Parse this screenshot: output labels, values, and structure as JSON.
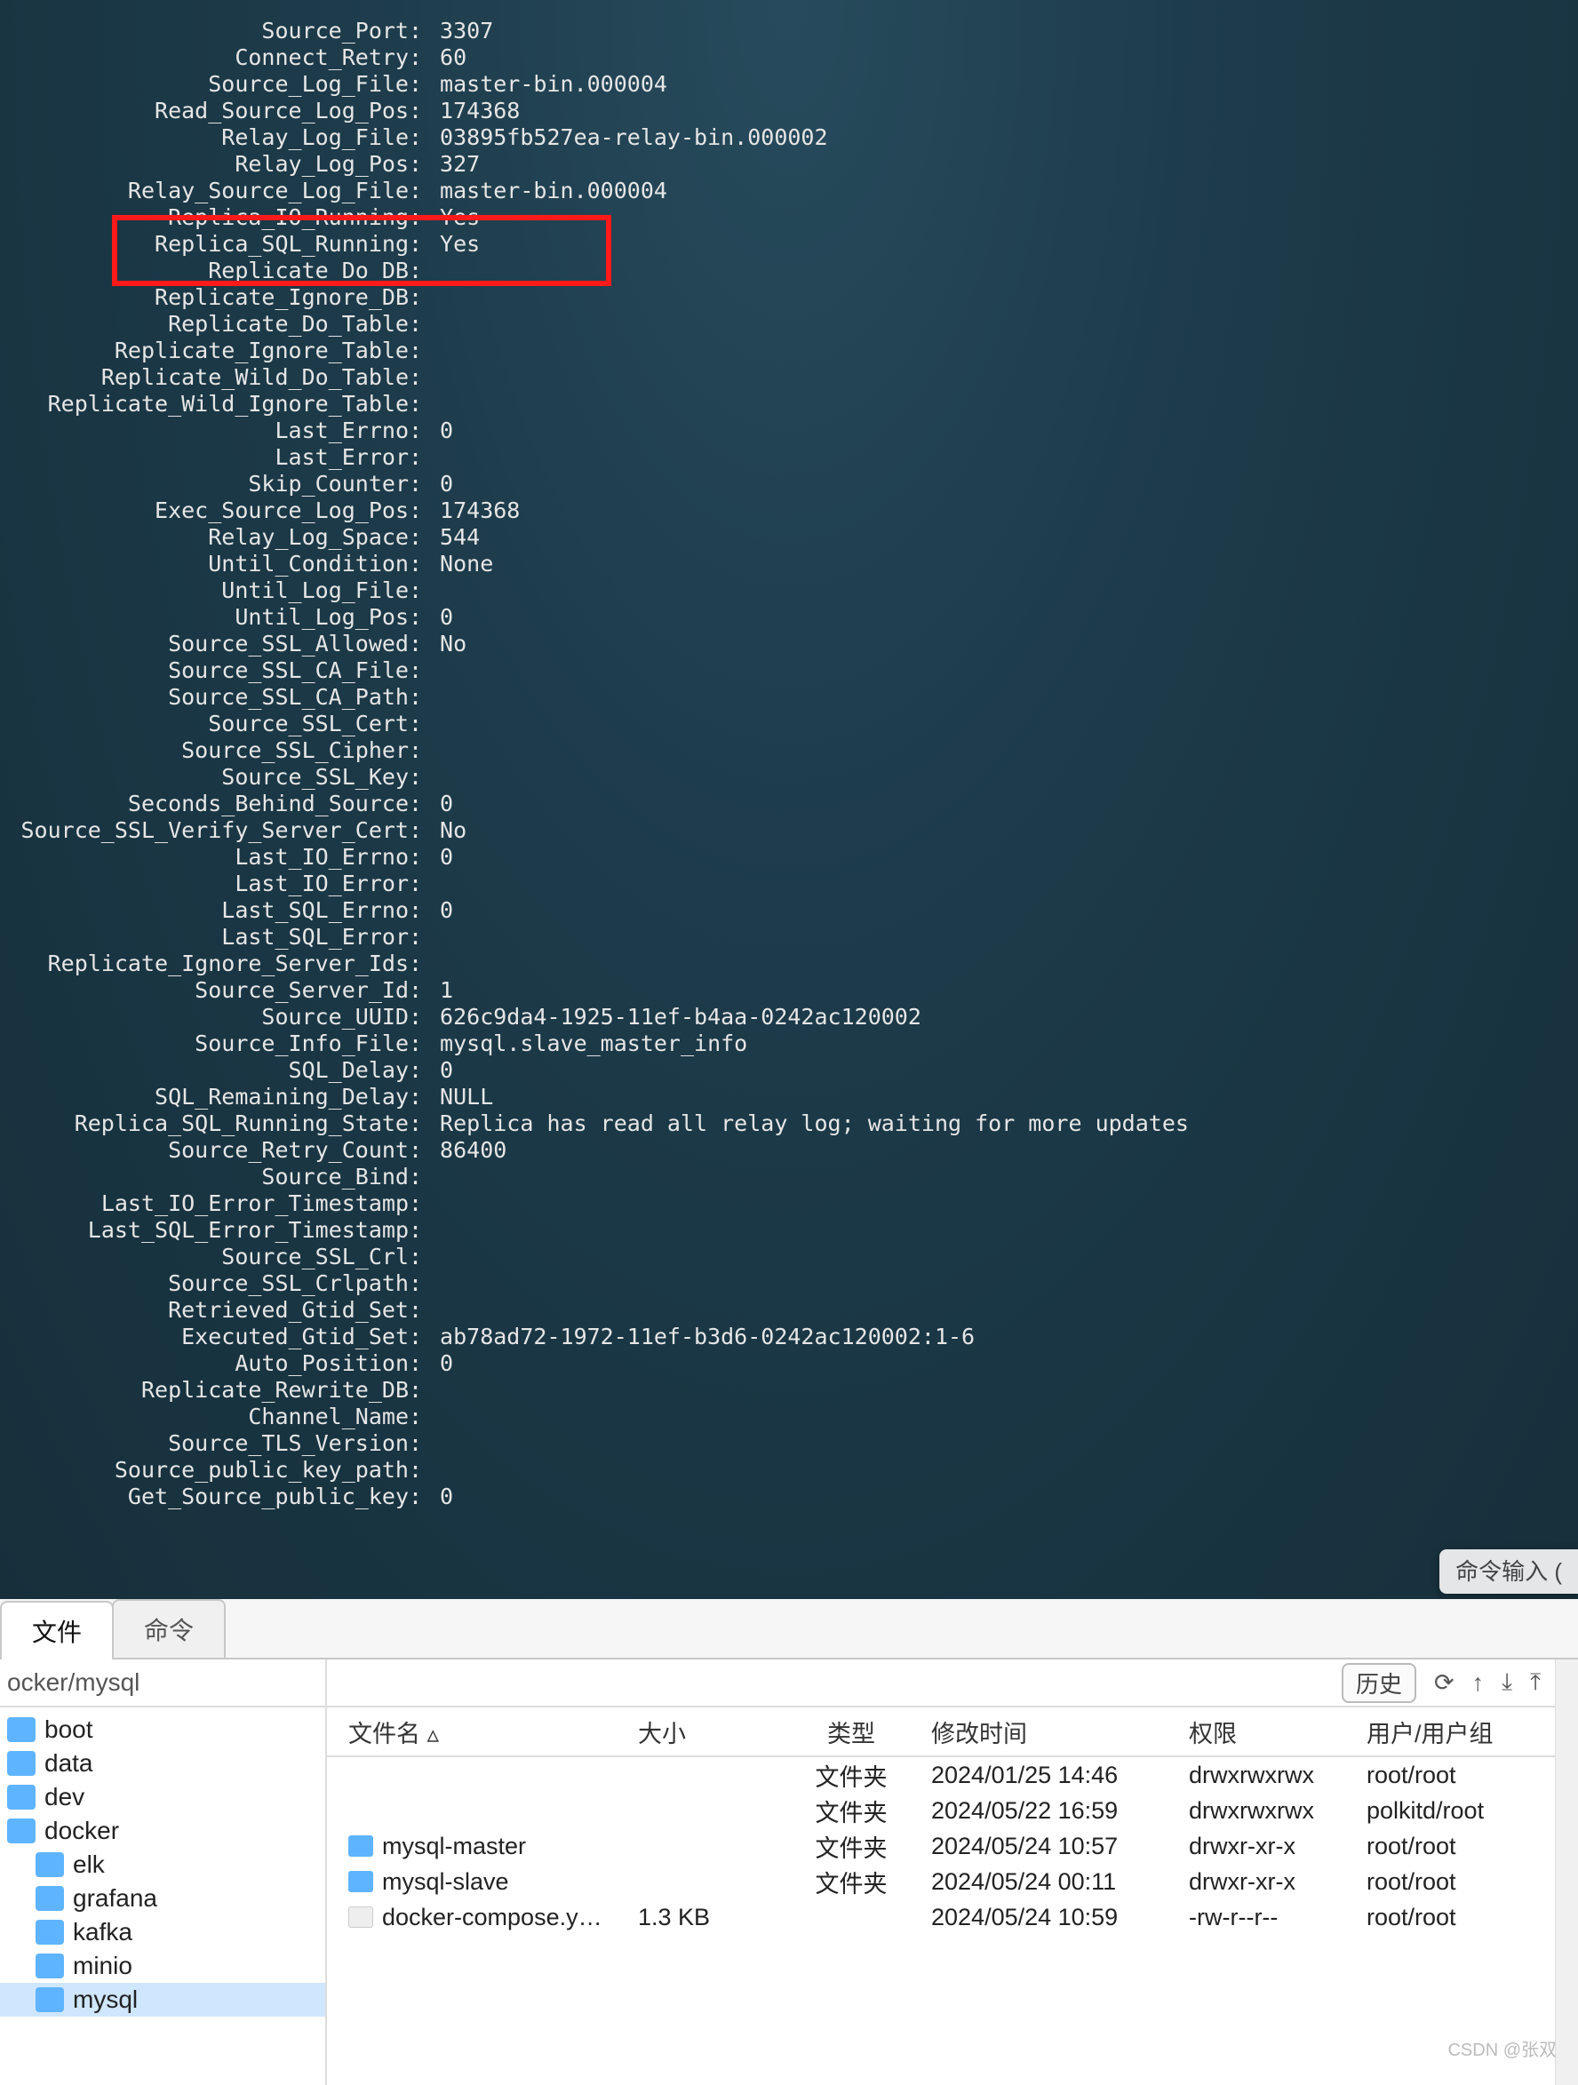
{
  "status": [
    {
      "label": "Source_Port",
      "value": "3307"
    },
    {
      "label": "Connect_Retry",
      "value": "60"
    },
    {
      "label": "Source_Log_File",
      "value": "master-bin.000004"
    },
    {
      "label": "Read_Source_Log_Pos",
      "value": "174368"
    },
    {
      "label": "Relay_Log_File",
      "value": "03895fb527ea-relay-bin.000002"
    },
    {
      "label": "Relay_Log_Pos",
      "value": "327"
    },
    {
      "label": "Relay_Source_Log_File",
      "value": "master-bin.000004"
    },
    {
      "label": "Replica_IO_Running",
      "value": "Yes"
    },
    {
      "label": "Replica_SQL_Running",
      "value": "Yes"
    },
    {
      "label": "Replicate_Do_DB",
      "value": ""
    },
    {
      "label": "Replicate_Ignore_DB",
      "value": ""
    },
    {
      "label": "Replicate_Do_Table",
      "value": ""
    },
    {
      "label": "Replicate_Ignore_Table",
      "value": ""
    },
    {
      "label": "Replicate_Wild_Do_Table",
      "value": ""
    },
    {
      "label": "Replicate_Wild_Ignore_Table",
      "value": ""
    },
    {
      "label": "Last_Errno",
      "value": "0"
    },
    {
      "label": "Last_Error",
      "value": ""
    },
    {
      "label": "Skip_Counter",
      "value": "0"
    },
    {
      "label": "Exec_Source_Log_Pos",
      "value": "174368"
    },
    {
      "label": "Relay_Log_Space",
      "value": "544"
    },
    {
      "label": "Until_Condition",
      "value": "None"
    },
    {
      "label": "Until_Log_File",
      "value": ""
    },
    {
      "label": "Until_Log_Pos",
      "value": "0"
    },
    {
      "label": "Source_SSL_Allowed",
      "value": "No"
    },
    {
      "label": "Source_SSL_CA_File",
      "value": ""
    },
    {
      "label": "Source_SSL_CA_Path",
      "value": ""
    },
    {
      "label": "Source_SSL_Cert",
      "value": ""
    },
    {
      "label": "Source_SSL_Cipher",
      "value": ""
    },
    {
      "label": "Source_SSL_Key",
      "value": ""
    },
    {
      "label": "Seconds_Behind_Source",
      "value": "0"
    },
    {
      "label": "Source_SSL_Verify_Server_Cert",
      "value": "No"
    },
    {
      "label": "Last_IO_Errno",
      "value": "0"
    },
    {
      "label": "Last_IO_Error",
      "value": ""
    },
    {
      "label": "Last_SQL_Errno",
      "value": "0"
    },
    {
      "label": "Last_SQL_Error",
      "value": ""
    },
    {
      "label": "Replicate_Ignore_Server_Ids",
      "value": ""
    },
    {
      "label": "Source_Server_Id",
      "value": "1"
    },
    {
      "label": "Source_UUID",
      "value": "626c9da4-1925-11ef-b4aa-0242ac120002"
    },
    {
      "label": "Source_Info_File",
      "value": "mysql.slave_master_info"
    },
    {
      "label": "SQL_Delay",
      "value": "0"
    },
    {
      "label": "SQL_Remaining_Delay",
      "value": "NULL"
    },
    {
      "label": "Replica_SQL_Running_State",
      "value": "Replica has read all relay log; waiting for more updates"
    },
    {
      "label": "Source_Retry_Count",
      "value": "86400"
    },
    {
      "label": "Source_Bind",
      "value": ""
    },
    {
      "label": "Last_IO_Error_Timestamp",
      "value": ""
    },
    {
      "label": "Last_SQL_Error_Timestamp",
      "value": ""
    },
    {
      "label": "Source_SSL_Crl",
      "value": ""
    },
    {
      "label": "Source_SSL_Crlpath",
      "value": ""
    },
    {
      "label": "Retrieved_Gtid_Set",
      "value": ""
    },
    {
      "label": "Executed_Gtid_Set",
      "value": "ab78ad72-1972-11ef-b3d6-0242ac120002:1-6"
    },
    {
      "label": "Auto_Position",
      "value": "0"
    },
    {
      "label": "Replicate_Rewrite_DB",
      "value": ""
    },
    {
      "label": "Channel_Name",
      "value": ""
    },
    {
      "label": "Source_TLS_Version",
      "value": ""
    },
    {
      "label": "Source_public_key_path",
      "value": ""
    },
    {
      "label": "Get_Source_public_key",
      "value": "0"
    }
  ],
  "cmd_hint": "命令输入 (",
  "tabs": {
    "file": "文件",
    "cmd": "命令"
  },
  "path": "ocker/mysql",
  "history_btn": "历史",
  "tree": [
    {
      "name": "boot",
      "depth": 0,
      "sel": false
    },
    {
      "name": "data",
      "depth": 0,
      "sel": false
    },
    {
      "name": "dev",
      "depth": 0,
      "sel": false
    },
    {
      "name": "docker",
      "depth": 0,
      "sel": false
    },
    {
      "name": "elk",
      "depth": 1,
      "sel": false
    },
    {
      "name": "grafana",
      "depth": 1,
      "sel": false
    },
    {
      "name": "kafka",
      "depth": 1,
      "sel": false
    },
    {
      "name": "minio",
      "depth": 1,
      "sel": false
    },
    {
      "name": "mysql",
      "depth": 1,
      "sel": true
    }
  ],
  "columns": {
    "name": "文件名",
    "size": "大小",
    "type": "类型",
    "mtime": "修改时间",
    "perm": "权限",
    "owner": "用户/用户组"
  },
  "sort_arrow": "▵",
  "rows": [
    {
      "name": "",
      "icon": "",
      "size": "",
      "type": "文件夹",
      "mtime": "2024/01/25 14:46",
      "perm": "drwxrwxrwx",
      "owner": "root/root"
    },
    {
      "name": "",
      "icon": "",
      "size": "",
      "type": "文件夹",
      "mtime": "2024/05/22 16:59",
      "perm": "drwxrwxrwx",
      "owner": "polkitd/root"
    },
    {
      "name": "mysql-master",
      "icon": "folder",
      "size": "",
      "type": "文件夹",
      "mtime": "2024/05/24 10:57",
      "perm": "drwxr-xr-x",
      "owner": "root/root"
    },
    {
      "name": "mysql-slave",
      "icon": "folder",
      "size": "",
      "type": "文件夹",
      "mtime": "2024/05/24 00:11",
      "perm": "drwxr-xr-x",
      "owner": "root/root"
    },
    {
      "name": "docker-compose.y…",
      "icon": "file",
      "size": "1.3 KB",
      "type": "",
      "mtime": "2024/05/24 10:59",
      "perm": "-rw-r--r--",
      "owner": "root/root"
    }
  ],
  "watermark": "CSDN @张双"
}
